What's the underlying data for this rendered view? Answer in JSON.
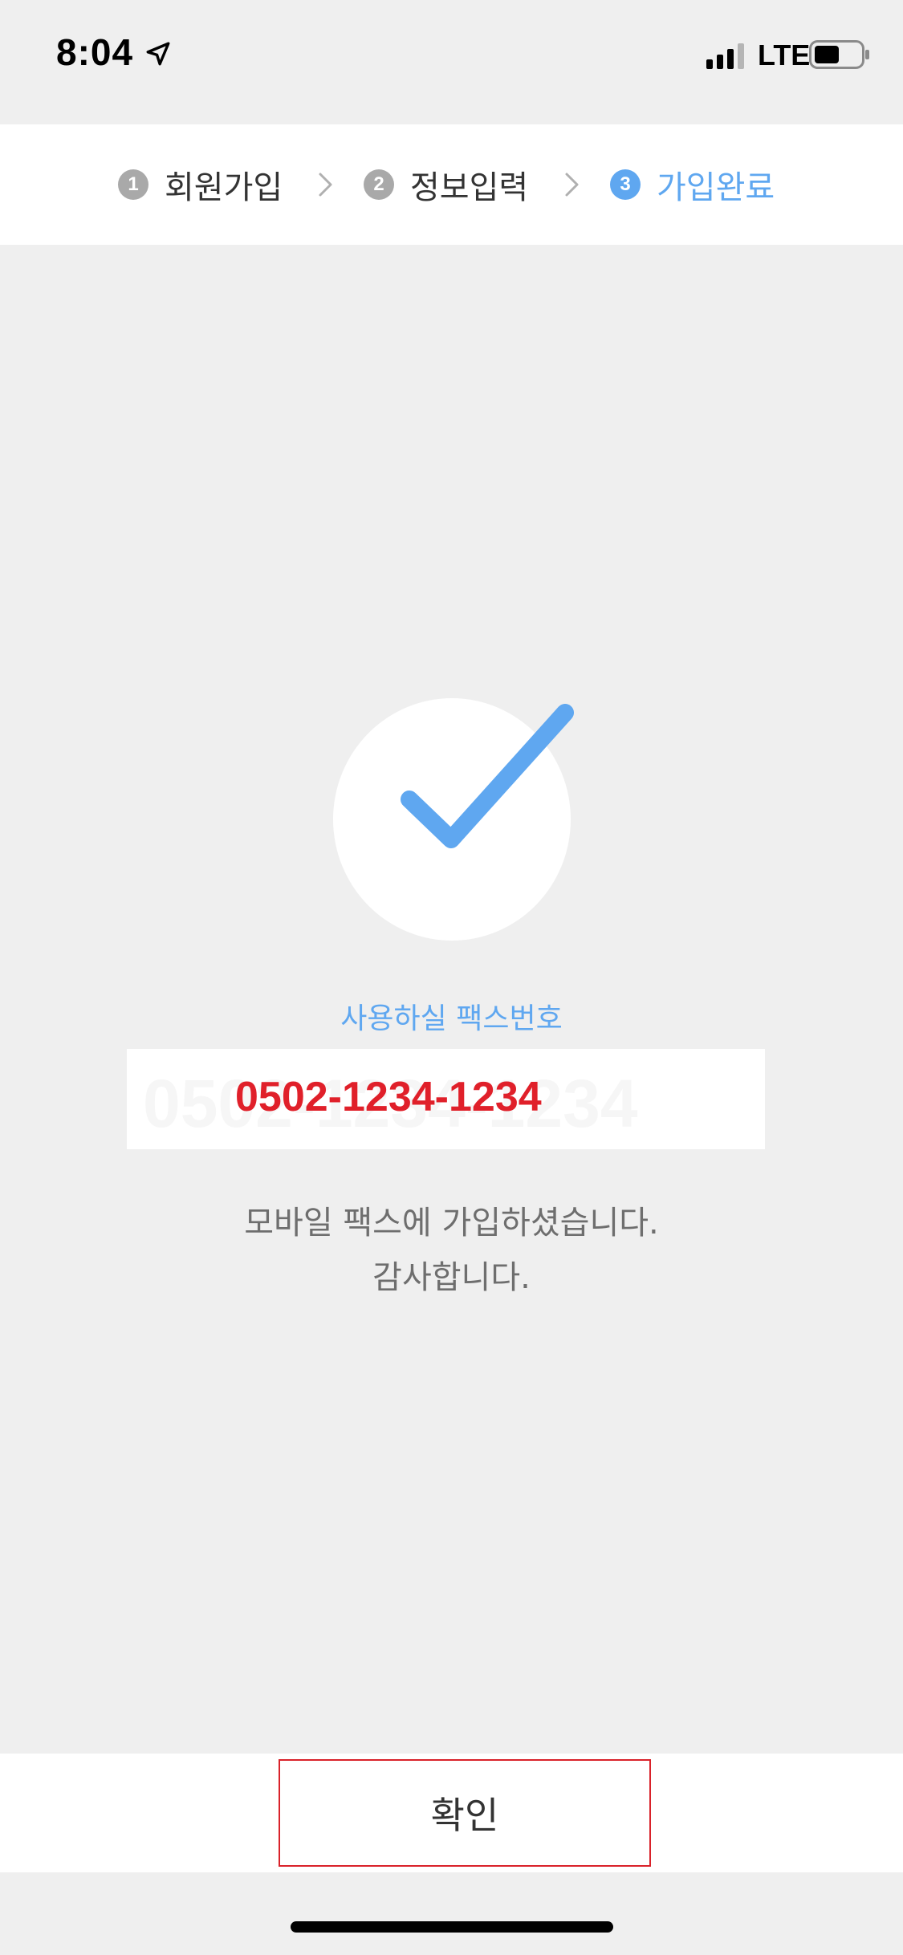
{
  "status_bar": {
    "time": "8:04",
    "network": "LTE",
    "icons": [
      "location-arrow-icon",
      "cellular-signal-icon",
      "battery-icon"
    ]
  },
  "stepper": {
    "steps": [
      {
        "number": "1",
        "label": "회원가입",
        "active": false
      },
      {
        "number": "2",
        "label": "정보입력",
        "active": false
      },
      {
        "number": "3",
        "label": "가입완료",
        "active": true
      }
    ],
    "separator_icon": "chevron-right-icon"
  },
  "main": {
    "success_icon": "checkmark-icon",
    "fax_caption": "사용하실 팩스번호",
    "fax_number": "0502-1234-1234",
    "message_line1": "모바일 팩스에 가입하셨습니다.",
    "message_line2": "감사합니다."
  },
  "footer": {
    "confirm_label": "확인"
  },
  "colors": {
    "accent": "#5fa7f0",
    "inactive_step": "#a9a9a9",
    "fax_number": "#e0202a",
    "highlight_border": "#d9222a",
    "background": "#efefef"
  }
}
